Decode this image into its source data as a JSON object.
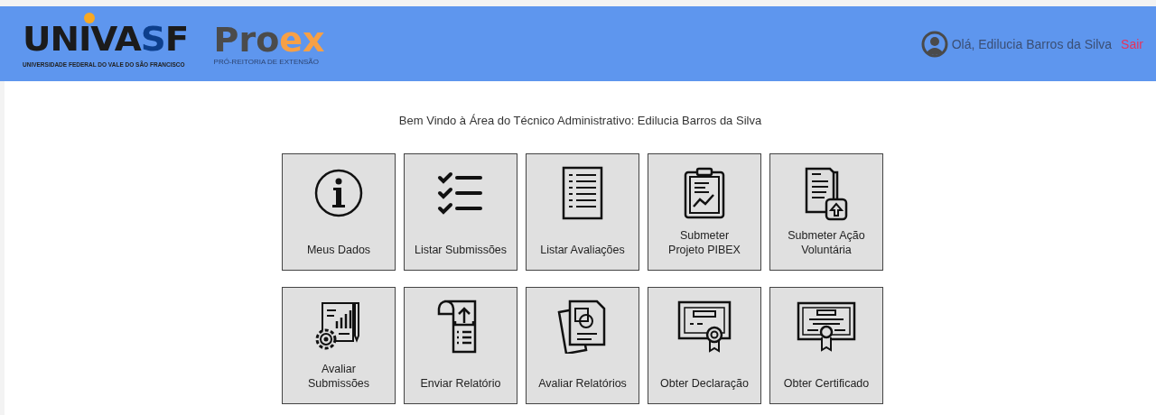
{
  "header": {
    "logo": {
      "wordmark": "UNIVASF",
      "tagline": "UNIVERSIDADE FEDERAL DO VALE DO SÃO FRANCISCO"
    },
    "partner_logo": {
      "wordmark": "Proex",
      "tagline": "PRÓ-REITORIA DE EXTENSÃO"
    },
    "greeting": "Olá, Edilucia Barros da Silva",
    "logout": "Sair"
  },
  "welcome": "Bem Vindo à Área do Técnico Administrativo: Edilucia Barros da Silva",
  "tiles": [
    {
      "label": "Meus Dados",
      "kind": "info"
    },
    {
      "label": "Listar Submissões",
      "kind": "checklist"
    },
    {
      "label": "Listar Avaliações",
      "kind": "list"
    },
    {
      "label": "Submeter\nProjeto PIBEX",
      "kind": "clipboard"
    },
    {
      "label": "Submeter Ação\nVoluntária",
      "kind": "upload"
    },
    {
      "label": "Avaliar\nSubmissões",
      "kind": "report"
    },
    {
      "label": "Enviar Relatório",
      "kind": "scroll"
    },
    {
      "label": "Avaliar Relatórios",
      "kind": "documents"
    },
    {
      "label": "Obter Declaração",
      "kind": "declaration"
    },
    {
      "label": "Obter Certificado",
      "kind": "certificate"
    }
  ]
}
